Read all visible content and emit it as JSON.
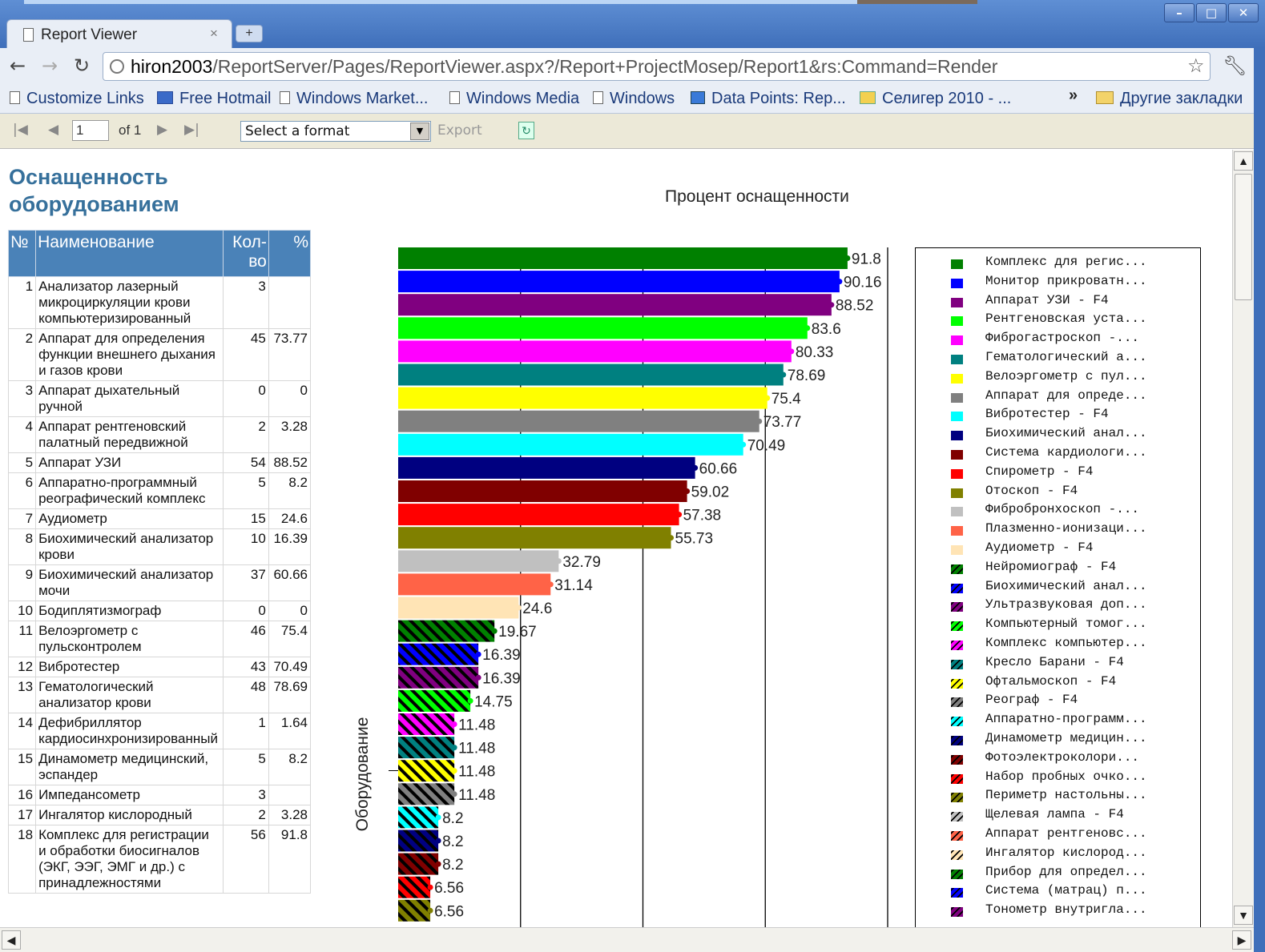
{
  "browser": {
    "tab_title": "Report Viewer",
    "tab_close": "×",
    "new_tab": "+",
    "url_host": "hiron2003",
    "url_path": "/ReportServer/Pages/ReportViewer.aspx?/Report+ProjectMosep/Report1&rs:Command=Render",
    "bookmarks": [
      "Customize Links",
      "Free Hotmail",
      "Windows Market...",
      "Windows Media",
      "Windows",
      "Data Points: Rep...",
      "Селигер 2010 - ...",
      "»",
      "Другие закладки"
    ]
  },
  "report_toolbar": {
    "page_value": "1",
    "of_label": "of 1",
    "format_placeholder": "Select a format",
    "export_label": "Export"
  },
  "report": {
    "title": "Оснащенность оборудованием",
    "table": {
      "headers": [
        "№",
        "Наименование",
        "Кол-во",
        "%"
      ],
      "rows": [
        [
          "1",
          "Анализатор лазерный микроциркуляции крови компьютеризированный",
          "3",
          ""
        ],
        [
          "2",
          "Аппарат для определения функции внешнего дыхания и газов крови",
          "45",
          "73.77"
        ],
        [
          "3",
          "Аппарат дыхательный ручной",
          "0",
          "0"
        ],
        [
          "4",
          "Аппарат рентгеновский палатный передвижной",
          "2",
          "3.28"
        ],
        [
          "5",
          "Аппарат УЗИ",
          "54",
          "88.52"
        ],
        [
          "6",
          "Аппаратно-программный реографический комплекс",
          "5",
          "8.2"
        ],
        [
          "7",
          "Аудиометр",
          "15",
          "24.6"
        ],
        [
          "8",
          "Биохимический анализатор крови",
          "10",
          "16.39"
        ],
        [
          "9",
          "Биохимический анализатор мочи",
          "37",
          "60.66"
        ],
        [
          "10",
          "Бодиплятизмограф",
          "0",
          "0"
        ],
        [
          "11",
          "Велоэргометр с пульсконтролем",
          "46",
          "75.4"
        ],
        [
          "12",
          "Вибротестер",
          "43",
          "70.49"
        ],
        [
          "13",
          "Гематологический анализатор крови",
          "48",
          "78.69"
        ],
        [
          "14",
          "Дефибриллятор кардиосинхронизированный",
          "1",
          "1.64"
        ],
        [
          "15",
          "Динамометр медицинский, эспандер",
          "5",
          "8.2"
        ],
        [
          "16",
          "Импедансометр",
          "3",
          ""
        ],
        [
          "17",
          "Ингалятор кислородный",
          "2",
          "3.28"
        ],
        [
          "18",
          "Комплекс для регистрации и обработки биосигналов (ЭКГ, ЭЭГ, ЭМГ и др.) с принадлежностями",
          "56",
          "91.8"
        ]
      ]
    }
  },
  "chart_data": {
    "type": "bar",
    "orientation": "horizontal",
    "title": "Процент оснащенности",
    "ylabel": "Оборудование",
    "xlim": [
      0,
      100
    ],
    "grid": "vertical",
    "legend_position": "right",
    "values": [
      91.8,
      90.16,
      88.52,
      83.6,
      80.33,
      78.69,
      75.4,
      73.77,
      70.49,
      60.66,
      59.02,
      57.38,
      55.73,
      32.79,
      31.14,
      24.6,
      19.67,
      16.39,
      16.39,
      14.75,
      11.48,
      11.48,
      11.48,
      11.48,
      8.2,
      8.2,
      8.2,
      6.56,
      6.56
    ],
    "labels": [
      "91.8",
      "90.16",
      "88.52",
      "83.6",
      "80.33",
      "78.69",
      "75.4",
      "73.77",
      "70.49",
      "60.66",
      "59.02",
      "57.38",
      "55.73",
      "32.79",
      "31.14",
      "24.6",
      "19.67",
      "16.39",
      "16.39",
      "14.75",
      "11.48",
      "11.48",
      "11.48",
      "11.48",
      "8.2",
      "8.2",
      "8.2",
      "6.56",
      "6.56"
    ],
    "colors": [
      "#008000",
      "#0000ff",
      "#800080",
      "#00ff00",
      "#ff00ff",
      "#008080",
      "#ffff00",
      "#808080",
      "#00ffff",
      "#000080",
      "#800000",
      "#ff0000",
      "#808000",
      "#c0c0c0",
      "#ff6347",
      "#ffe4b5",
      "#008000",
      "#0000ff",
      "#800080",
      "#00ff00",
      "#ff00ff",
      "#008080",
      "#ffff00",
      "#808080",
      "#00ffff",
      "#000080",
      "#800000",
      "#ff0000",
      "#808000"
    ],
    "hatched_from_index": 16,
    "legend": [
      "Комплекс для регис...",
      "Монитор прикроватн...",
      "Аппарат УЗИ - F4",
      "Рентгеновская уста...",
      "Фиброгастроскоп -...",
      "Гематологический а...",
      "Велоэргометр с пул...",
      "Аппарат для опреде...",
      "Вибротестер - F4",
      "Биохимический анал...",
      "Система кардиологи...",
      "Спирометр - F4",
      "Отоскоп - F4",
      "Фибробронхоскоп -...",
      "Плазменно-ионизаци...",
      "Аудиометр - F4",
      "Нейромиограф - F4",
      "Биохимический анал...",
      "Ультразвуковая доп...",
      "Компьютерный томог...",
      "Комплекс компьютер...",
      "Кресло Барани - F4",
      "Офтальмоскоп - F4",
      "Реограф - F4",
      "Аппаратно-программ...",
      "Динамометр медицин...",
      "Фотоэлектроколори...",
      "Набор пробных очко...",
      "Периметр настольны...",
      "Щелевая лампа - F4",
      "Аппарат рентгеновс...",
      "Ингалятор кислород...",
      "Прибор для определ...",
      "Система (матрац) п...",
      "Тонометр внутригла..."
    ],
    "legend_colors": [
      "#008000",
      "#0000ff",
      "#800080",
      "#00ff00",
      "#ff00ff",
      "#008080",
      "#ffff00",
      "#808080",
      "#00ffff",
      "#000080",
      "#800000",
      "#ff0000",
      "#808000",
      "#c0c0c0",
      "#ff6347",
      "#ffe4b5",
      "#008000",
      "#0000ff",
      "#800080",
      "#00ff00",
      "#ff00ff",
      "#008080",
      "#ffff00",
      "#808080",
      "#00ffff",
      "#000080",
      "#800000",
      "#ff0000",
      "#808000",
      "#c0c0c0",
      "#ff6347",
      "#ffe4b5",
      "#008000",
      "#0000ff",
      "#800080"
    ]
  }
}
